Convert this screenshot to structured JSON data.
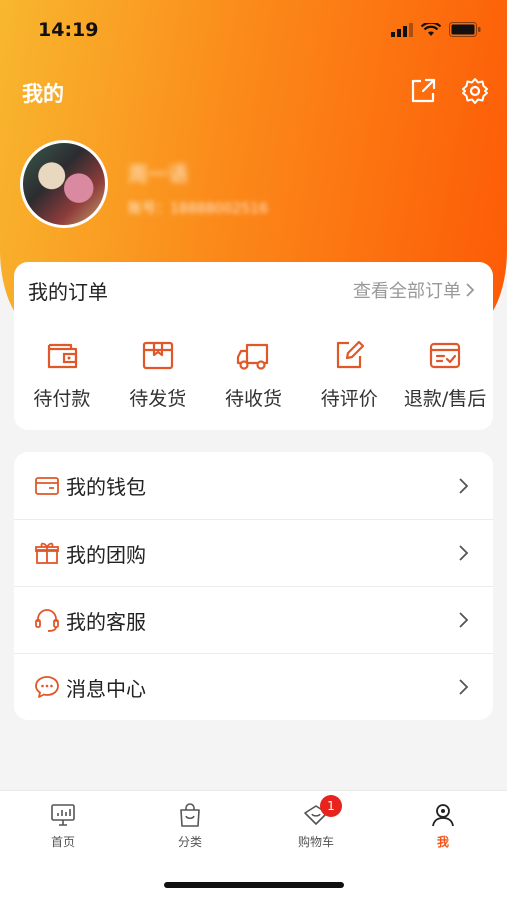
{
  "status_bar": {
    "time": "14:19"
  },
  "header": {
    "title": "我的"
  },
  "user": {
    "name": "周一语",
    "account": "账号：18888002516"
  },
  "orders": {
    "title": "我的订单",
    "view_all": "查看全部订单",
    "items": [
      {
        "label": "待付款",
        "icon": "wallet-icon"
      },
      {
        "label": "待发货",
        "icon": "package-icon"
      },
      {
        "label": "待收货",
        "icon": "truck-icon"
      },
      {
        "label": "待评价",
        "icon": "edit-icon"
      },
      {
        "label": "退款/售后",
        "icon": "refund-card-icon"
      }
    ]
  },
  "menu": [
    {
      "label": "我的钱包",
      "icon": "wallet-icon"
    },
    {
      "label": "我的团购",
      "icon": "gift-icon"
    },
    {
      "label": "我的客服",
      "icon": "headset-icon"
    },
    {
      "label": "消息中心",
      "icon": "chat-icon"
    }
  ],
  "tabbar": {
    "items": [
      {
        "label": "首页",
        "icon": "monitor-icon"
      },
      {
        "label": "分类",
        "icon": "shopping-bag-icon"
      },
      {
        "label": "购物车",
        "icon": "cart-icon",
        "badge": "1"
      },
      {
        "label": "我",
        "icon": "profile-icon",
        "active": true
      }
    ]
  },
  "colors": {
    "accent": "#f2541b",
    "gradient_start": "#f8b72f",
    "gradient_end": "#fd5a06",
    "badge": "#e8221d"
  }
}
